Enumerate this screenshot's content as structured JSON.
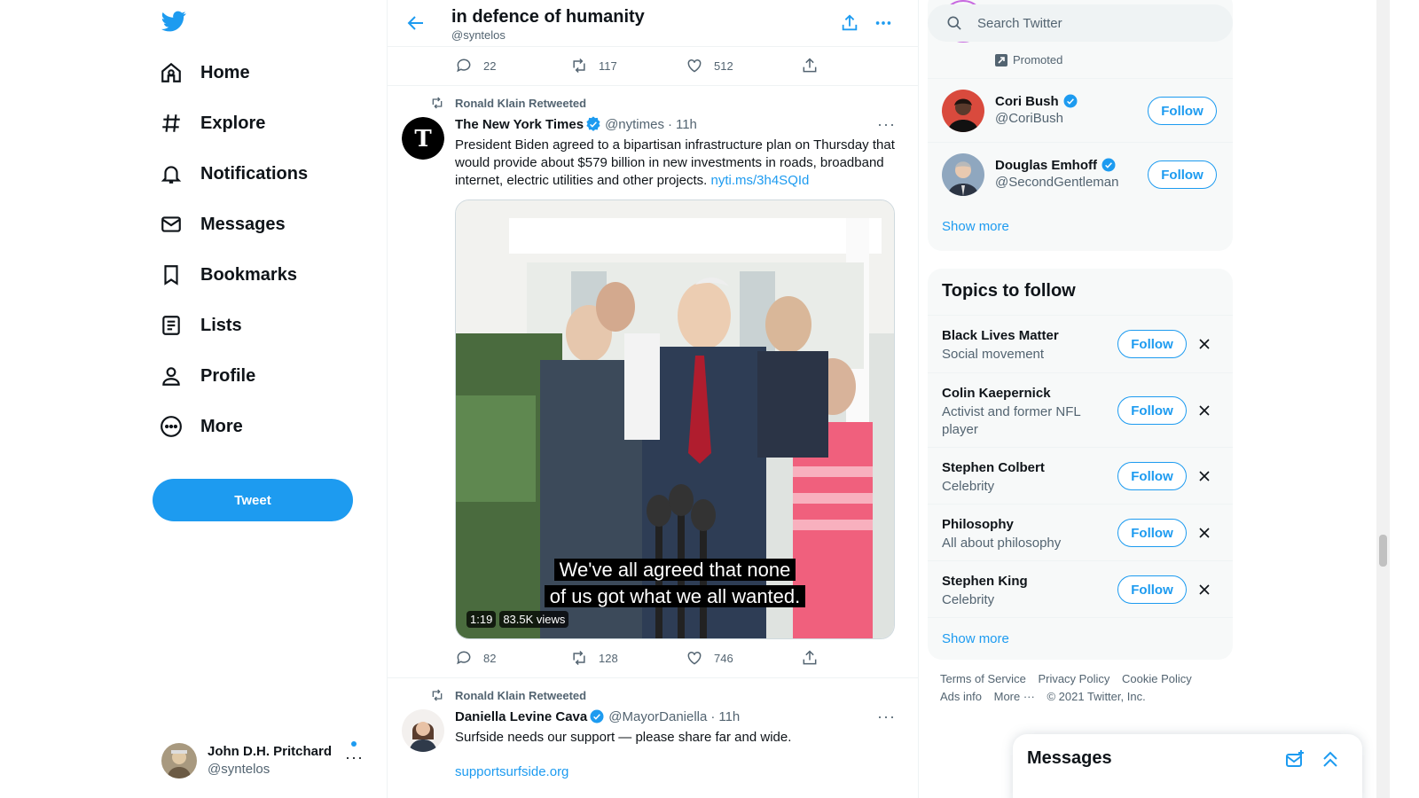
{
  "colors": {
    "accent": "#1d9bf0",
    "text": "#0f1419",
    "secondary": "#536471"
  },
  "nav": {
    "items": [
      {
        "label": "Home",
        "icon": "home-icon"
      },
      {
        "label": "Explore",
        "icon": "hashtag-icon"
      },
      {
        "label": "Notifications",
        "icon": "bell-icon"
      },
      {
        "label": "Messages",
        "icon": "envelope-icon"
      },
      {
        "label": "Bookmarks",
        "icon": "bookmark-icon"
      },
      {
        "label": "Lists",
        "icon": "list-icon"
      },
      {
        "label": "Profile",
        "icon": "person-icon"
      },
      {
        "label": "More",
        "icon": "more-circle-icon"
      }
    ],
    "tweet_button": "Tweet",
    "account": {
      "name": "John D.H. Pritchard",
      "handle": "@syntelos"
    }
  },
  "header": {
    "title": "in defence of humanity",
    "handle": "@syntelos"
  },
  "top_actions": {
    "replies": "22",
    "retweets": "117",
    "likes": "512"
  },
  "tweets": [
    {
      "retweeted_by": "Ronald Klain Retweeted",
      "name": "The New York Times",
      "handle": "@nytimes",
      "sep": "·",
      "time": "11h",
      "text": "President Biden agreed to a bipartisan infrastructure plan on Thursday that would provide about $579 billion in new investments in roads, broadband internet, electric utilities and other projects. ",
      "link": "nyti.ms/3h4SQId",
      "media": {
        "caption_line1": "We've all agreed that none",
        "caption_line2": "of us got what we all wanted.",
        "duration": "1:19",
        "views": "83.5K views"
      },
      "replies": "82",
      "retweets": "128",
      "likes": "746"
    },
    {
      "retweeted_by": "Ronald Klain Retweeted",
      "name": "Daniella Levine Cava",
      "handle": "@MayorDaniella",
      "sep": "·",
      "time": "11h",
      "text": "Surfside needs our support — please share far and wide.",
      "link": "supportsurfside.org"
    }
  ],
  "search": {
    "placeholder": "Search Twitter"
  },
  "who_to_follow": {
    "promoted": "Promoted",
    "accounts": [
      {
        "name": "Cori Bush",
        "handle": "@CoriBush",
        "button": "Follow"
      },
      {
        "name": "Douglas Emhoff",
        "handle": "@SecondGentleman",
        "button": "Follow"
      }
    ],
    "show_more": "Show more"
  },
  "topics": {
    "title": "Topics to follow",
    "items": [
      {
        "name": "Black Lives Matter",
        "sub": "Social movement",
        "button": "Follow"
      },
      {
        "name": "Colin Kaepernick",
        "sub": "Activist and former NFL player",
        "button": "Follow"
      },
      {
        "name": "Stephen Colbert",
        "sub": "Celebrity",
        "button": "Follow"
      },
      {
        "name": "Philosophy",
        "sub": "All about philosophy",
        "button": "Follow"
      },
      {
        "name": "Stephen King",
        "sub": "Celebrity",
        "button": "Follow"
      }
    ],
    "show_more": "Show more"
  },
  "footer": {
    "terms": "Terms of Service",
    "privacy": "Privacy Policy",
    "cookie": "Cookie Policy",
    "ads": "Ads info",
    "more": "More ···",
    "copyright": "© 2021 Twitter, Inc."
  },
  "messages_drawer": {
    "title": "Messages"
  }
}
